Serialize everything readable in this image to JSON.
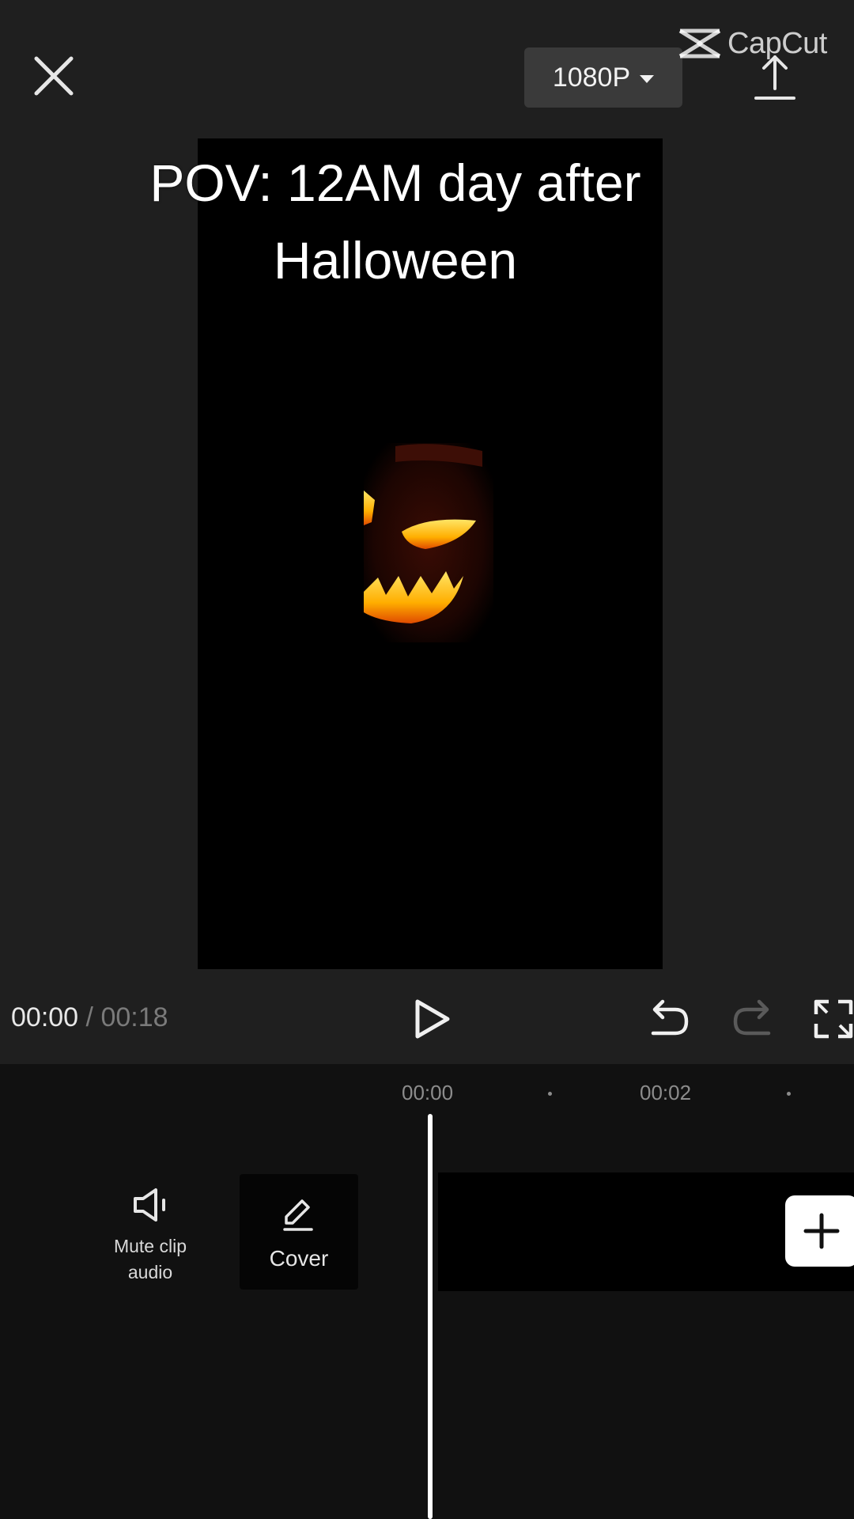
{
  "app": {
    "watermark": "CapCut"
  },
  "toolbar": {
    "close_icon": "close-icon",
    "resolution_label": "1080P",
    "export_icon": "export-upload-icon"
  },
  "preview": {
    "caption_line1": "POV: 12AM day after",
    "caption_line2": "Halloween"
  },
  "playback": {
    "current_time": "00:00",
    "separator": "/",
    "total_time": "00:18",
    "play_icon": "play-icon",
    "undo_icon": "undo-icon",
    "redo_icon": "redo-icon",
    "fullscreen_icon": "fullscreen-icon"
  },
  "timeline": {
    "ruler_labels": [
      "00:00",
      "00:02"
    ],
    "mute_label": "Mute clip audio",
    "cover_label": "Cover",
    "add_icon": "plus-icon"
  },
  "colors": {
    "background": "#1f1f1f",
    "timeline_background": "#111111",
    "resolution_button": "#3a3a3a",
    "pumpkin_glow": "#ffb000"
  }
}
